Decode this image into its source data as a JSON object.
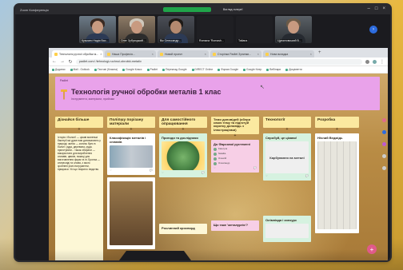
{
  "meeting": {
    "app_title": "Zoom Конференція",
    "recording_label": "",
    "view_label": "Вигляд галереї",
    "participants": [
      {
        "name": "Кузьмич Надія Вас..."
      },
      {
        "name": "Олег Зубрицький..."
      },
      {
        "name": "Вік Олександр..."
      },
      {
        "name": "Romana 'Romash..."
      },
      {
        "name": "Tatiana"
      },
      {
        "name": "Цумиловський В..."
      }
    ],
    "next_arrow": "›"
  },
  "browser": {
    "tabs": [
      {
        "label": "Технологія ручної обробки м..."
      },
      {
        "label": "Наша Професія..."
      },
      {
        "label": "Новий проект"
      },
      {
        "label": "Сторінка Padlet Зупинки..."
      },
      {
        "label": "Нова вкладка"
      }
    ],
    "url": "padlet.com/  /tehnologi-ruchnoi-obrobki-metaliv",
    "bookmarks": [
      "Додатки",
      "Mail - Outlook",
      "Тестові (Класна)",
      "Google Класс",
      "Padlet",
      "Переклад Google",
      "DIRECT Online",
      "Форма Google",
      "Google Keep",
      "Вебінари",
      "Документи"
    ]
  },
  "board": {
    "author": "Padlet",
    "title": "Технологія ручної обробки металів 1 клас",
    "subtitle": "Інструменти, матеріали, прийоми",
    "columns": [
      {
        "header": "Дізнайся більше",
        "cards": [
          {
            "title": "",
            "text": "Історія і біології — цікаві маленькі бактерії які дуже нам допомагають у природі; залізо — колись було в болоті; руда, деревина, руди, приготувати... також збирали — використати для вироблення сплавів, цвяхів, ножиці для виготовлення форм та ін. Бронза — сплав міді та олова, з якого зроблені різні інструменти, прикраси. Усі що творило людство.",
            "kind": "yellow"
          }
        ]
      },
      {
        "header": "Поліпшу порізану матеріали",
        "cards": [
          {
            "title": "Класифікація металів і сплавів",
            "text": "",
            "kind": "white",
            "pic": "mats"
          },
          {
            "title": "",
            "text": "",
            "kind": "white",
            "pic": "photo"
          }
        ]
      },
      {
        "header": "Для самостійного опрацювання",
        "cards": [
          {
            "title": "Пригоди та дослідники",
            "text": "",
            "kind": "mint",
            "pic": "tree"
          },
          {
            "title": "Рослинний кросворд",
            "text": "",
            "kind": "yellow"
          }
        ]
      },
      {
        "header": "Теми доповідей (обери свою тему та підготуй коротку доповідь з ілюстраціями)",
        "cards": [
          {
            "title": "До Фарсової рустемені",
            "text": "",
            "kind": "pink",
            "comments": [
              "Kateryna",
              "Nataliia",
              "Олексій",
              "Олександр"
            ]
          },
          {
            "title": "Що таке 'металургія'?",
            "text": "",
            "kind": "pink"
          }
        ]
      },
      {
        "header": "Технології",
        "cards": [
          {
            "title": "Спробуй, це цікаво!",
            "text": "",
            "kind": "mint",
            "pic": "paper",
            "pic_label": "Карбування на металі"
          },
          {
            "title": "Олімпіада і конкурс",
            "text": "",
            "kind": "mint"
          }
        ]
      },
      {
        "header": "Розробка",
        "cards": [
          {
            "title": "Нічний Ведмідь",
            "text": "",
            "kind": "white",
            "pic": "sketch"
          }
        ]
      }
    ]
  }
}
